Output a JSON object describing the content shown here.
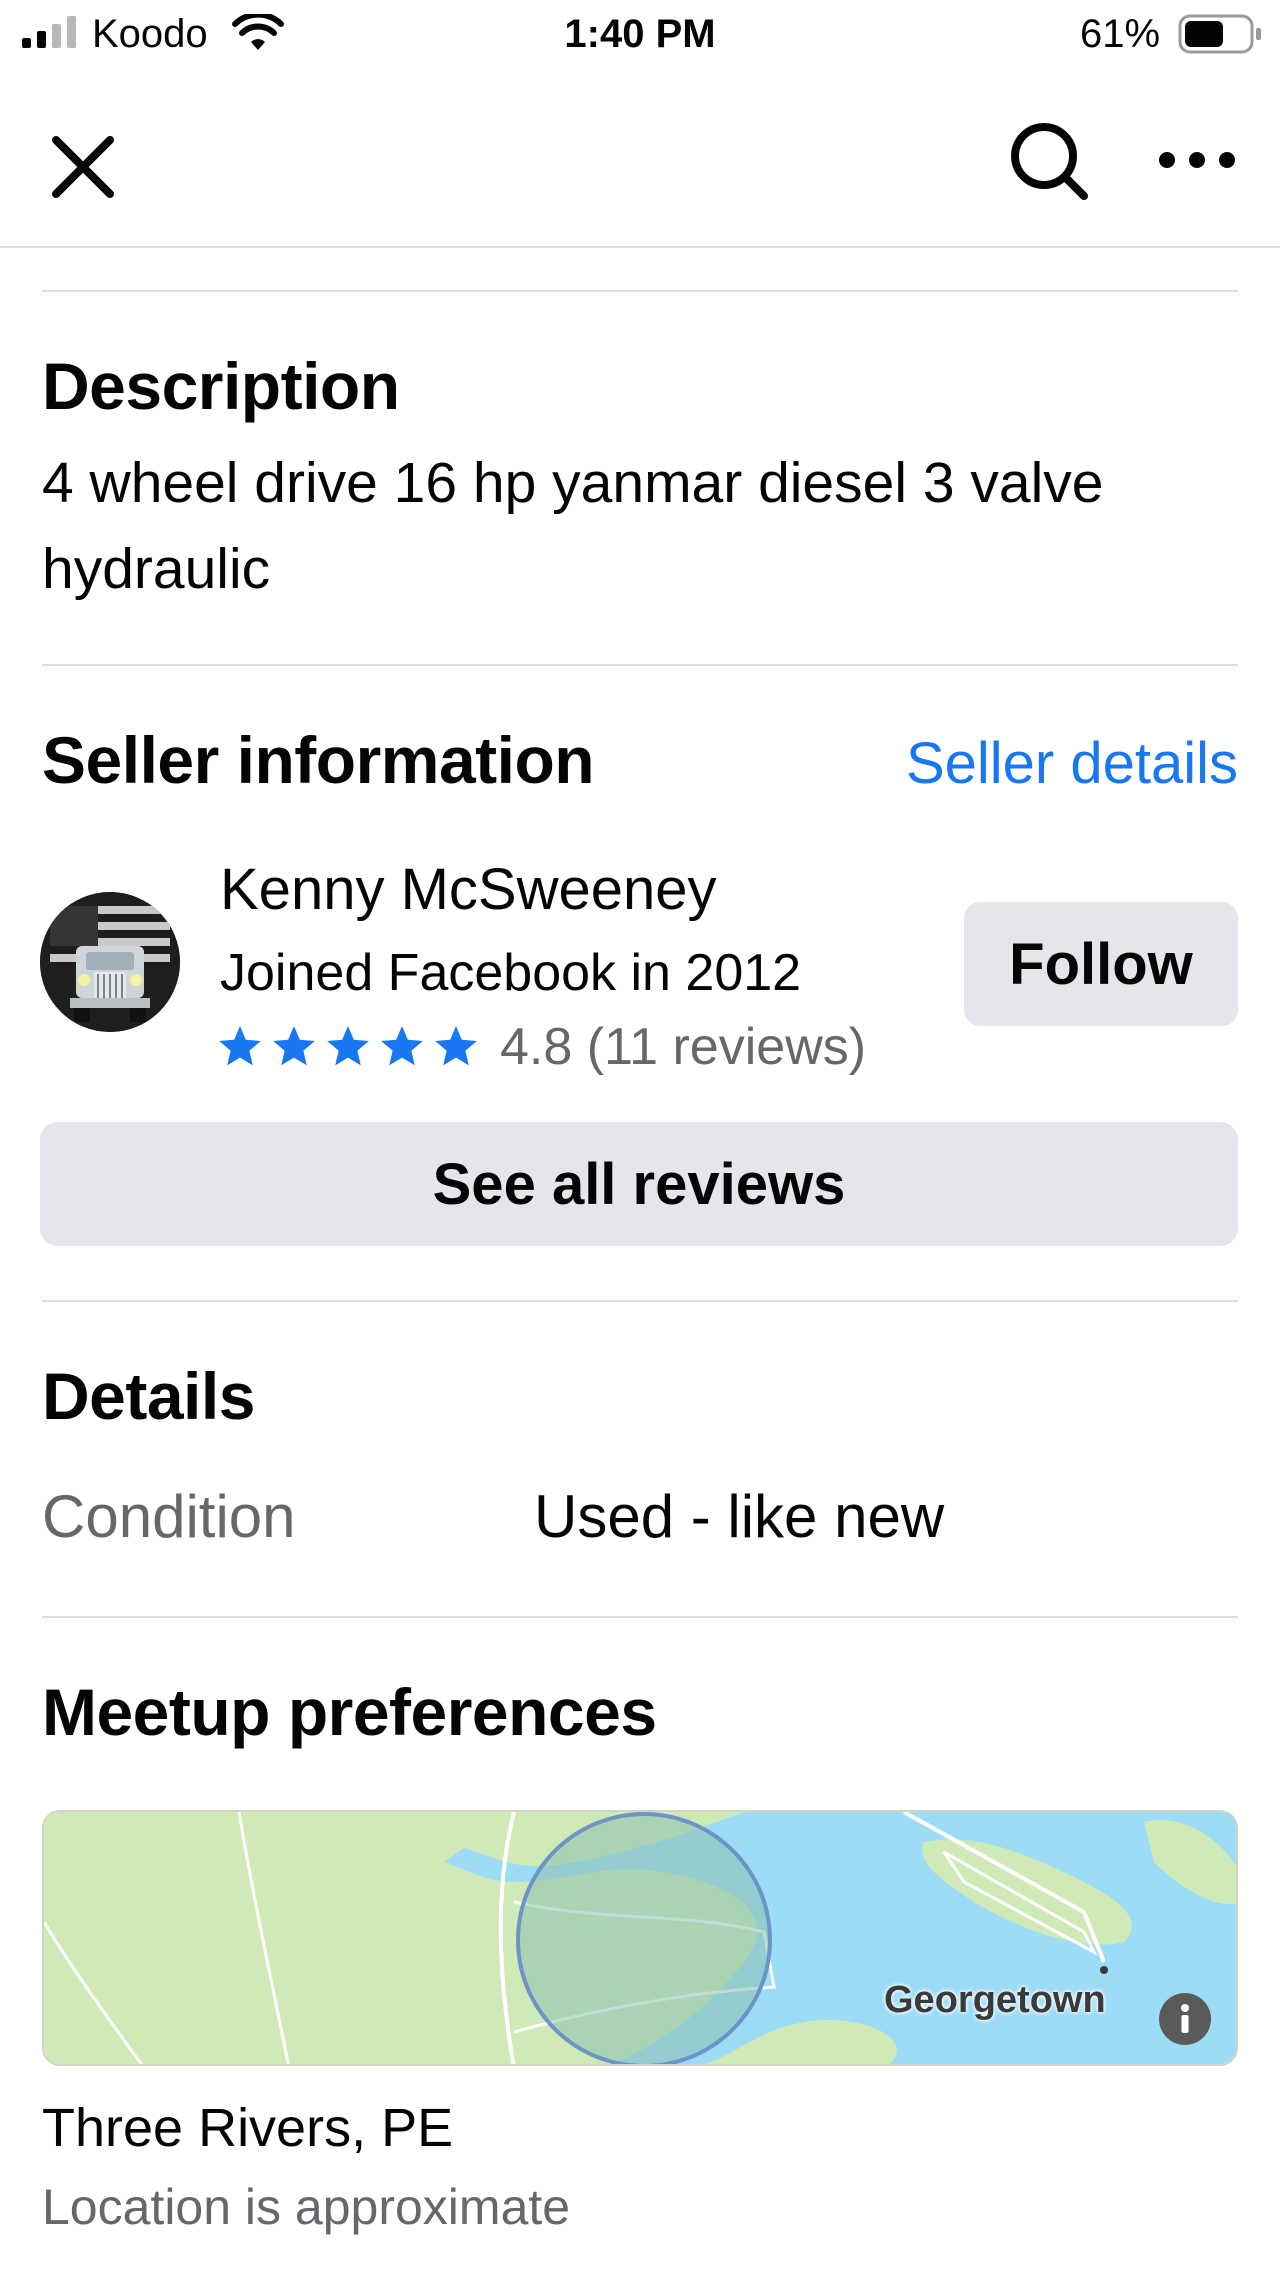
{
  "status_bar": {
    "carrier": "Koodo",
    "time": "1:40 PM",
    "battery_percent": "61%",
    "battery_level": 0.61,
    "signal_bars": 2,
    "icons": [
      "signal-icon",
      "wifi-icon",
      "battery-icon"
    ]
  },
  "nav": {
    "icons": [
      "close-icon",
      "search-icon",
      "more-icon"
    ]
  },
  "description": {
    "title": "Description",
    "text": "4 wheel drive 16 hp yanmar diesel 3 valve hydraulic"
  },
  "seller": {
    "title": "Seller information",
    "details_link": "Seller details",
    "name": "Kenny McSweeney",
    "joined": "Joined Facebook in 2012",
    "stars": 5,
    "rating_text": "4.8 (11 reviews)",
    "follow_label": "Follow",
    "reviews_label": "See all reviews"
  },
  "details": {
    "title": "Details",
    "rows": [
      {
        "label": "Condition",
        "value": "Used - like new"
      }
    ]
  },
  "meetup": {
    "title": "Meetup preferences",
    "map_label": "Georgetown",
    "location": "Three Rivers, PE",
    "location_note": "Location is approximate"
  },
  "colors": {
    "accent": "#1877f2",
    "text": "#050505",
    "secondary_text": "#65676b",
    "button_bg": "#e4e6eb",
    "divider": "#dadde1",
    "map_land": "#cfeab6",
    "map_water": "#9ddcf7"
  }
}
